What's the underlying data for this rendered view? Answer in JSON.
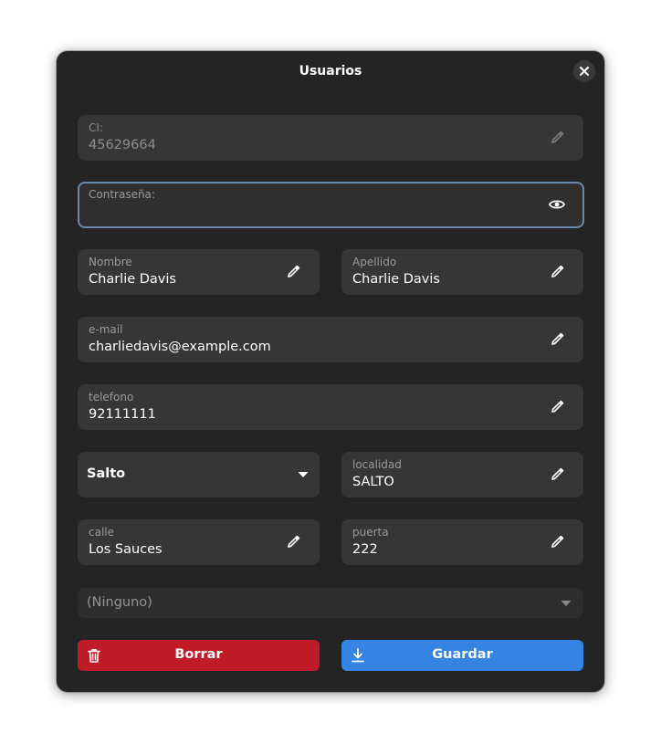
{
  "window": {
    "title": "Usuarios"
  },
  "fields": {
    "ci": {
      "label": "CI:",
      "value": "45629664"
    },
    "password": {
      "label": "Contraseña:",
      "value": ""
    },
    "nombre": {
      "label": "Nombre",
      "value": "Charlie Davis"
    },
    "apellido": {
      "label": "Apellido",
      "value": "Charlie Davis"
    },
    "email": {
      "label": "e-mail",
      "value": "charliedavis@example.com"
    },
    "telefono": {
      "label": "telefono",
      "value": "92111111"
    },
    "departamento": {
      "value": "Salto"
    },
    "localidad": {
      "label": "localidad",
      "value": "SALTO"
    },
    "calle": {
      "label": "calle",
      "value": "Los Sauces"
    },
    "puerta": {
      "label": "puerta",
      "value": "222"
    },
    "extra_combo": {
      "value": "(Ninguno)"
    }
  },
  "buttons": {
    "delete": {
      "label": "Borrar",
      "color": "#c01c28",
      "icon": "trash-icon"
    },
    "save": {
      "label": "Guardar",
      "color": "#3584e4",
      "icon": "download-icon"
    }
  },
  "colors": {
    "window_bg": "#242424",
    "row_bg": "#363636",
    "focus_border": "#6b89ab"
  }
}
